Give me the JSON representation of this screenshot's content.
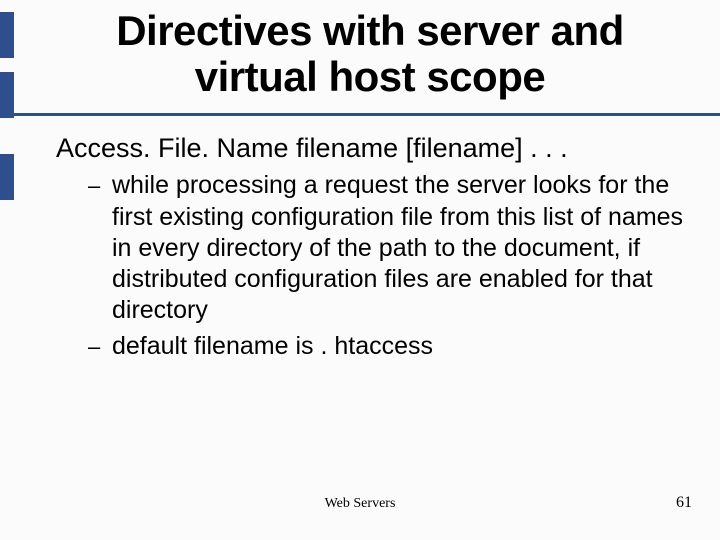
{
  "title": "Directives with server and virtual host scope",
  "body": {
    "heading": "Access. File. Name filename [filename] . . .",
    "subitems": [
      "while processing a request the server looks for the first existing configuration file from this list of names in every directory of the path to the document, if distributed configuration files are enabled for that directory",
      "default filename is . htaccess"
    ]
  },
  "footer": {
    "center": "Web Servers",
    "page": "61"
  },
  "markers": {
    "positions": [
      12,
      72,
      154
    ]
  },
  "colors": {
    "accent": "#2e4e8e"
  }
}
